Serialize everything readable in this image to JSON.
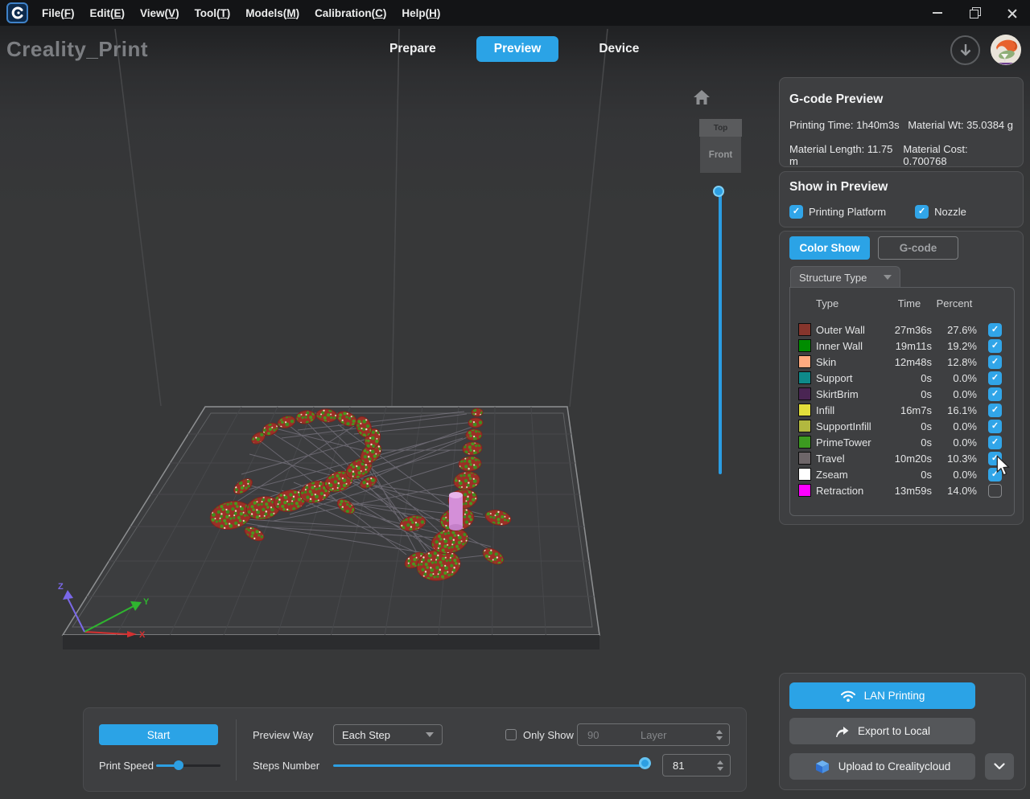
{
  "icons": {
    "check": "✓"
  },
  "menu": {
    "items": [
      {
        "prefix": "File(",
        "key": "F",
        "suffix": ")"
      },
      {
        "prefix": "Edit(",
        "key": "E",
        "suffix": ")"
      },
      {
        "prefix": "View(",
        "key": "V",
        "suffix": ")"
      },
      {
        "prefix": "Tool(",
        "key": "T",
        "suffix": ")"
      },
      {
        "prefix": "Models(",
        "key": "M",
        "suffix": ")"
      },
      {
        "prefix": "Calibration(",
        "key": "C",
        "suffix": ")"
      },
      {
        "prefix": "Help(",
        "key": "H",
        "suffix": ")"
      }
    ]
  },
  "header": {
    "app_title": "Creality_Print",
    "tabs": [
      {
        "label": "Prepare"
      },
      {
        "label": "Preview"
      },
      {
        "label": "Device"
      }
    ]
  },
  "viewcube": {
    "top": "Top",
    "front": "Front"
  },
  "axes": {
    "x": "X",
    "y": "Y",
    "z": "Z"
  },
  "gcode_preview": {
    "title": "G-code Preview",
    "stats": [
      {
        "label": "Printing Time: 1h40m3s"
      },
      {
        "label": "Material Wt: 35.0384 g"
      },
      {
        "label": "Material Length: 11.75 m"
      },
      {
        "label": "Material Cost: 0.700768"
      }
    ]
  },
  "show_in_preview": {
    "title": "Show in Preview",
    "options": [
      {
        "label": "Printing Platform",
        "checked": true
      },
      {
        "label": "Nozzle",
        "checked": true
      }
    ]
  },
  "color_show": {
    "mode_buttons": [
      {
        "label": "Color Show",
        "active": true
      },
      {
        "label": "G-code",
        "active": false
      }
    ],
    "dropdown_value": "Structure Type",
    "table": {
      "headers": {
        "type": "Type",
        "time": "Time",
        "percent": "Percent"
      },
      "rows": [
        {
          "type": "Outer Wall",
          "time": "27m36s",
          "percent": "27.6%",
          "color": "#86352c",
          "checked": true
        },
        {
          "type": "Inner Wall",
          "time": "19m11s",
          "percent": "19.2%",
          "color": "#008c00",
          "checked": true
        },
        {
          "type": "Skin",
          "time": "12m48s",
          "percent": "12.8%",
          "color": "#ffaa7f",
          "checked": true
        },
        {
          "type": "Support",
          "time": "0s",
          "percent": "0.0%",
          "color": "#0e8a8a",
          "checked": true
        },
        {
          "type": "SkirtBrim",
          "time": "0s",
          "percent": "0.0%",
          "color": "#4a2553",
          "checked": true
        },
        {
          "type": "Infill",
          "time": "16m7s",
          "percent": "16.1%",
          "color": "#e3df3b",
          "checked": true
        },
        {
          "type": "SupportInfill",
          "time": "0s",
          "percent": "0.0%",
          "color": "#b2b83f",
          "checked": true
        },
        {
          "type": "PrimeTower",
          "time": "0s",
          "percent": "0.0%",
          "color": "#3c9a20",
          "checked": true
        },
        {
          "type": "Travel",
          "time": "10m20s",
          "percent": "10.3%",
          "color": "#6e6669",
          "checked": true
        },
        {
          "type": "Zseam",
          "time": "0s",
          "percent": "0.0%",
          "color": "#ffffff",
          "checked": true
        },
        {
          "type": "Retraction",
          "time": "13m59s",
          "percent": "14.0%",
          "color": "#ff00ff",
          "checked": false
        }
      ]
    }
  },
  "playback": {
    "start_label": "Start",
    "print_speed_label": "Print Speed",
    "preview_way_label": "Preview Way",
    "preview_way_value": "Each Step",
    "steps_number_label": "Steps Number",
    "only_show_label": "Only Show",
    "layer_value": "90",
    "layer_unit": "Layer",
    "steps_value": "81"
  },
  "actions": {
    "lan_label": "LAN Printing",
    "export_label": "Export to Local",
    "upload_label": "Upload to Crealitycloud"
  },
  "colors": {
    "accent": "#2ba3e6",
    "nozzle": "#d48fd8"
  }
}
